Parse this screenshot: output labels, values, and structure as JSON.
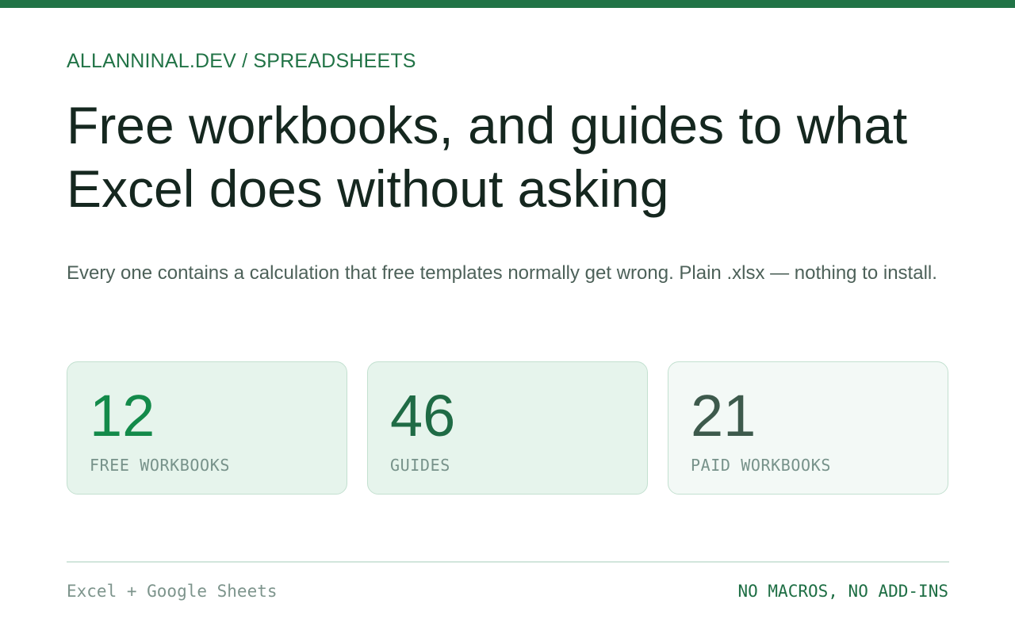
{
  "header": {
    "breadcrumb": "ALLANNINAL.DEV / SPREADSHEETS",
    "title": "Free workbooks, and guides to what Excel does without asking",
    "subtitle": "Every one contains a calculation that free templates normally get wrong. Plain .xlsx — nothing to install."
  },
  "stats": [
    {
      "value": "12",
      "label": "FREE WORKBOOKS"
    },
    {
      "value": "46",
      "label": "GUIDES"
    },
    {
      "value": "21",
      "label": "PAID WORKBOOKS"
    }
  ],
  "footer": {
    "left": "Excel + Google Sheets",
    "right": "NO MACROS, NO ADD-INS"
  },
  "colors": {
    "brand": "#217346",
    "stat_free": "#138a4a",
    "stat_guides": "#1f6b45",
    "stat_paid": "#3d5a4c"
  }
}
